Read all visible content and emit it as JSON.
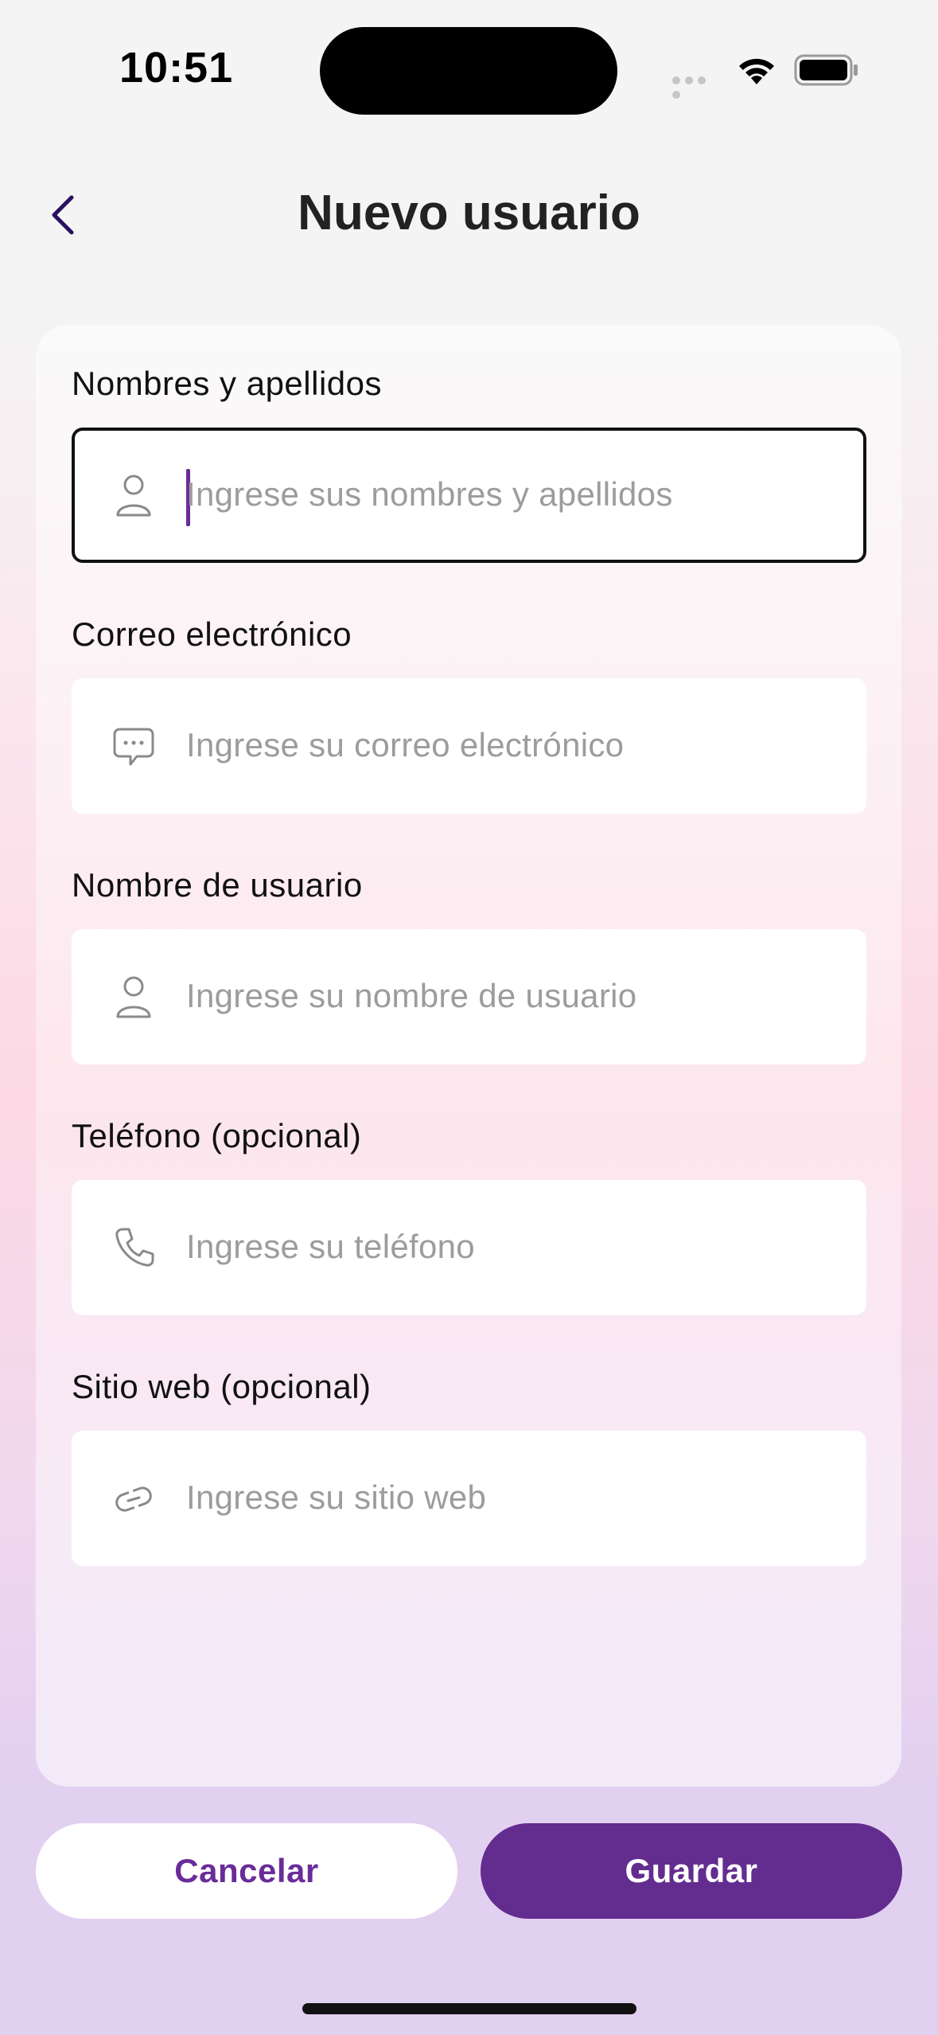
{
  "status_bar": {
    "time": "10:51"
  },
  "header": {
    "title": "Nuevo usuario"
  },
  "form": {
    "fields": [
      {
        "label": "Nombres y apellidos",
        "placeholder": "Ingrese sus nombres y apellidos",
        "icon": "person-icon",
        "focused": true
      },
      {
        "label": "Correo electrónico",
        "placeholder": "Ingrese su correo electrónico",
        "icon": "chat-bubble-icon"
      },
      {
        "label": "Nombre de usuario",
        "placeholder": "Ingrese su nombre de usuario",
        "icon": "person-icon"
      },
      {
        "label": "Teléfono (opcional)",
        "placeholder": "Ingrese su teléfono",
        "icon": "phone-icon"
      },
      {
        "label": "Sitio web (opcional)",
        "placeholder": "Ingrese su sitio web",
        "icon": "link-icon"
      }
    ]
  },
  "actions": {
    "cancel_label": "Cancelar",
    "save_label": "Guardar"
  },
  "colors": {
    "accent": "#632c8f",
    "accent_text": "#6a2c99",
    "placeholder": "#9c9c9c"
  }
}
